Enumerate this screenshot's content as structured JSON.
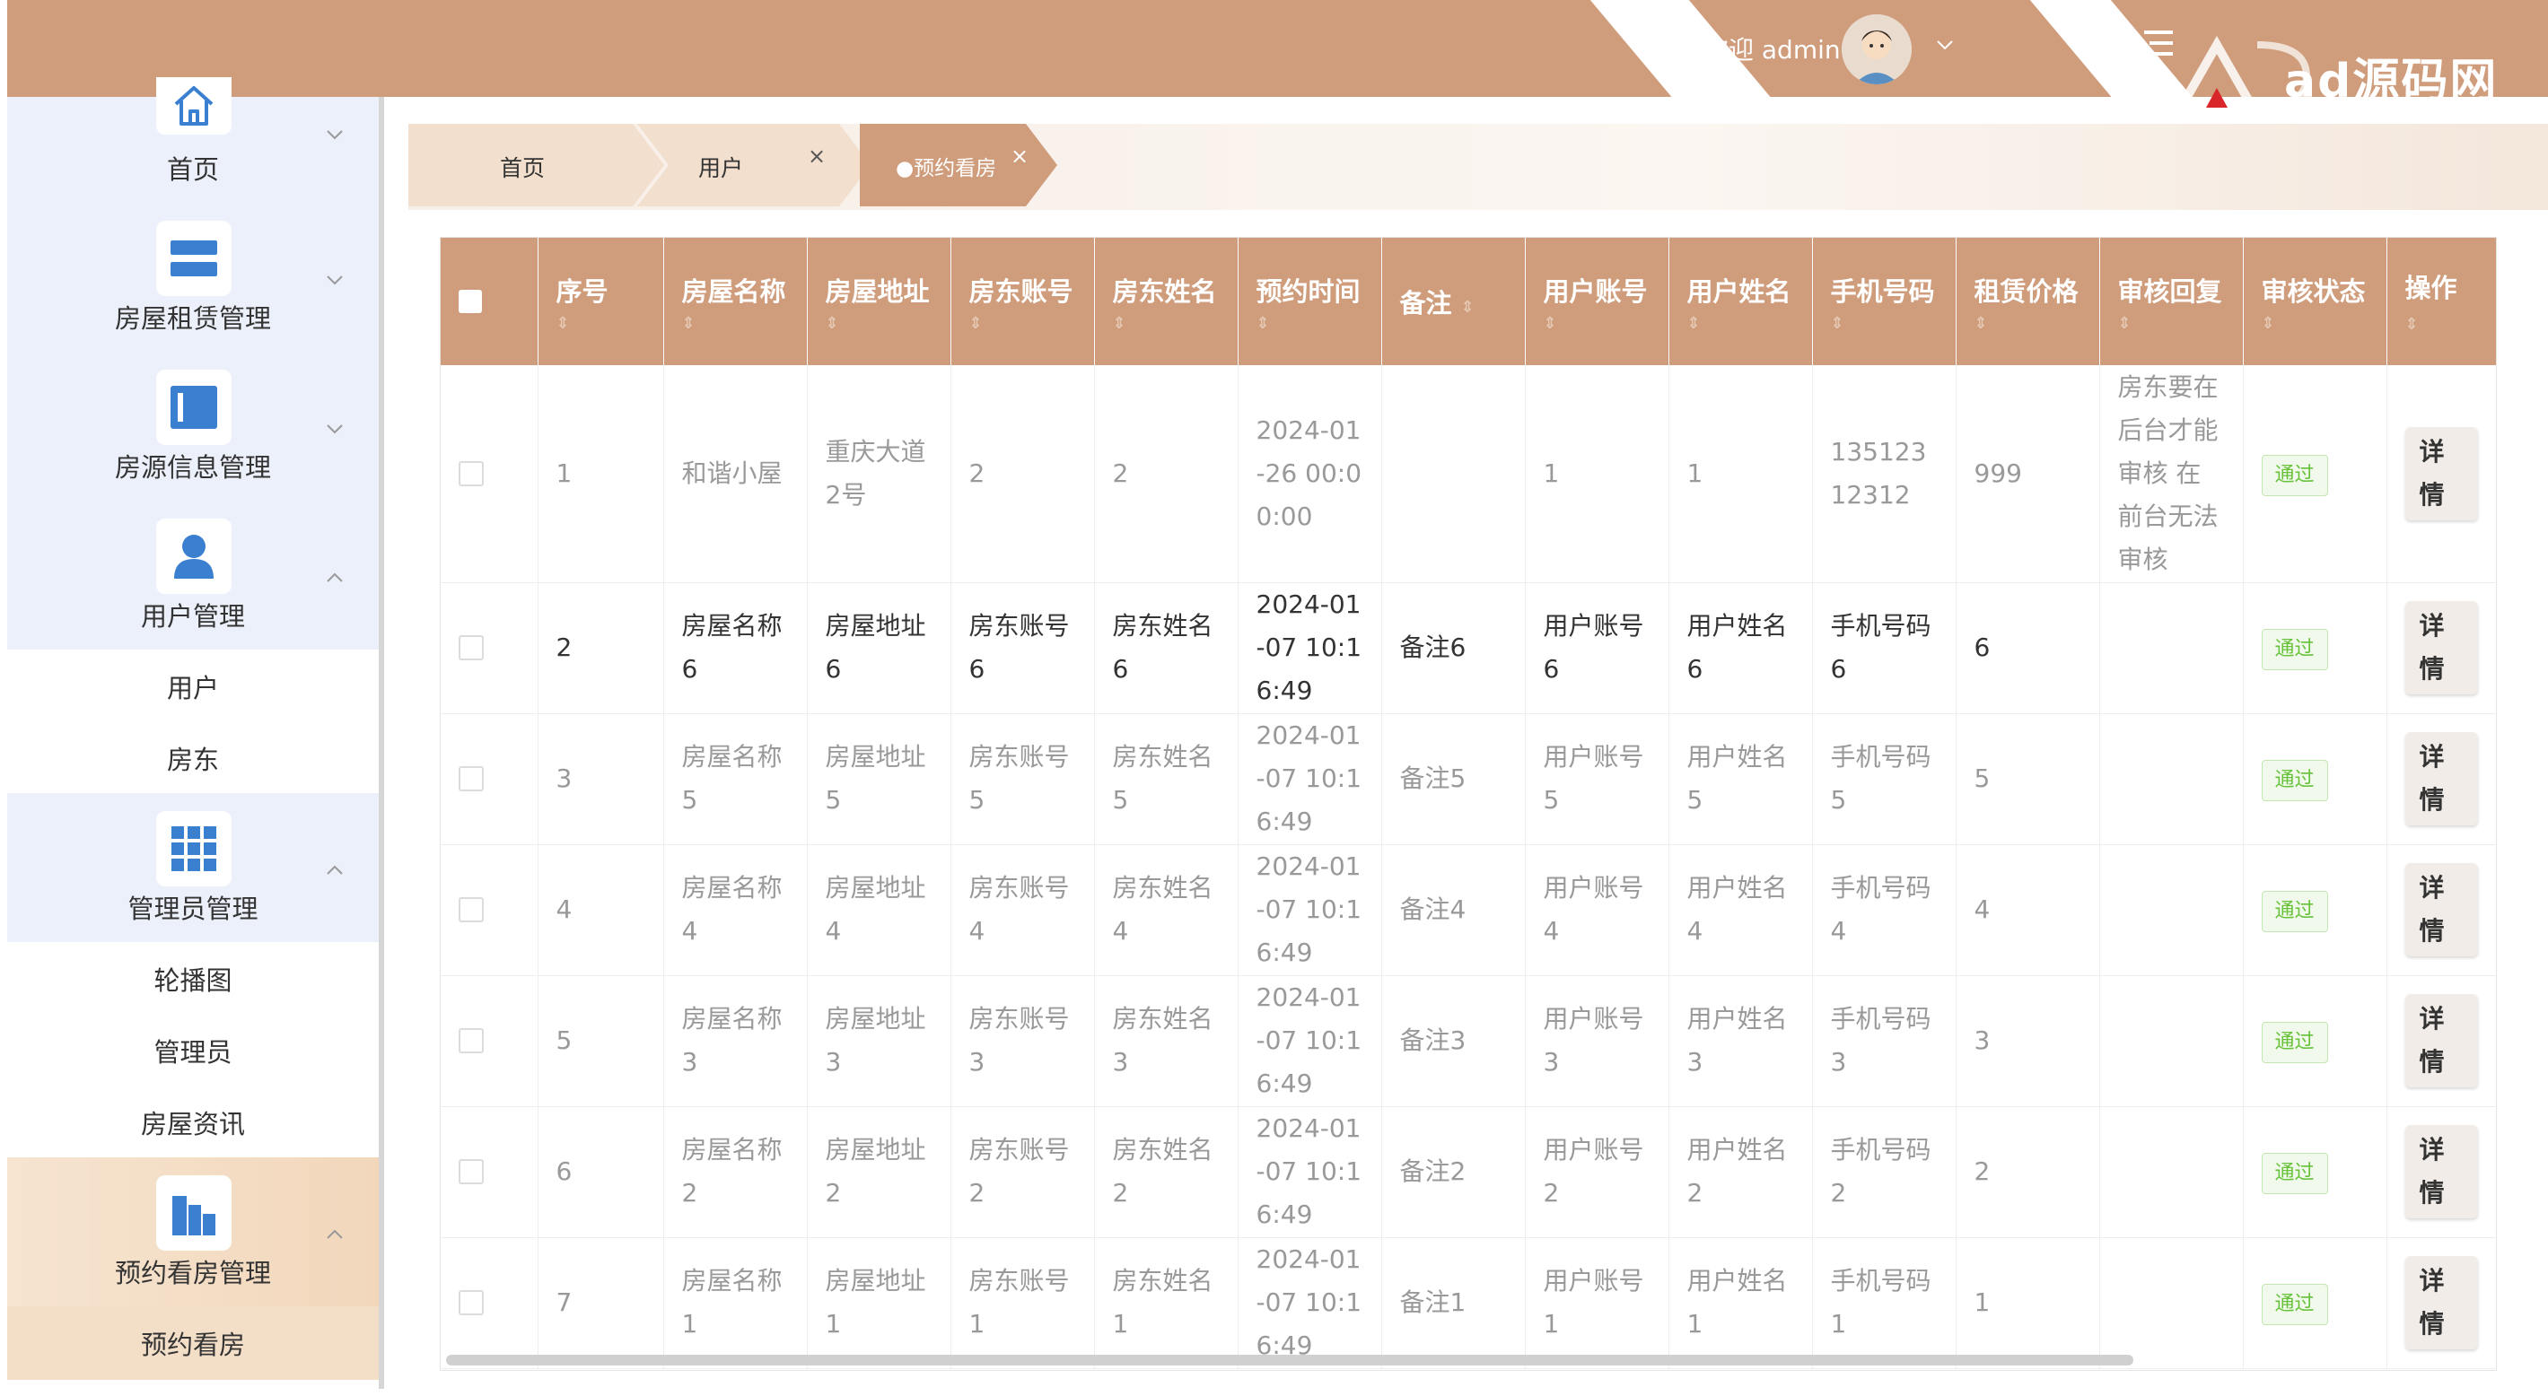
{
  "header": {
    "welcome": "欢迎 admin",
    "logo_text": "ad源码网",
    "colors": {
      "primary": "#cf9d7c",
      "sidebar_bg": "#ecf0fa",
      "badge_green": "#67c23a"
    }
  },
  "sidebar": {
    "menus": [
      {
        "label": "首页",
        "icon": "home-icon"
      },
      {
        "label": "房屋租赁管理",
        "icon": "list-icon"
      },
      {
        "label": "房源信息管理",
        "icon": "panel-icon"
      },
      {
        "label": "用户管理",
        "icon": "user-icon",
        "children": [
          "用户",
          "房东"
        ]
      },
      {
        "label": "管理员管理",
        "icon": "grid-icon",
        "children": [
          "轮播图",
          "管理员",
          "房屋资讯"
        ]
      },
      {
        "label": "预约看房管理",
        "icon": "building-icon",
        "children": [
          "预约看房"
        ]
      }
    ]
  },
  "tabs": [
    {
      "label": "首页",
      "closable": false
    },
    {
      "label": "用户",
      "closable": true
    },
    {
      "label": "●预约看房",
      "closable": true,
      "active": true
    }
  ],
  "table": {
    "columns": [
      "序号",
      "房屋名称",
      "房屋地址",
      "房东账号",
      "房东姓名",
      "预约时间",
      "备注",
      "用户账号",
      "用户姓名",
      "手机号码",
      "租赁价格",
      "审核回复",
      "审核状态",
      "操作"
    ],
    "sort_icon": "⇕",
    "detail_label": "详情",
    "rows": [
      {
        "cells": [
          "1",
          "和谐小屋",
          "重庆大道2号",
          "2",
          "2",
          "2024-01-26 00:00:00",
          "",
          "1",
          "1",
          "13512312312",
          "999",
          "房东要在后台才能审核 在前台无法审核"
        ],
        "status": "通过"
      },
      {
        "cells": [
          "2",
          "房屋名称6",
          "房屋地址6",
          "房东账号6",
          "房东姓名6",
          "2024-01-07 10:16:49",
          "备注6",
          "用户账号6",
          "用户姓名6",
          "手机号码6",
          "6",
          ""
        ],
        "status": "通过"
      },
      {
        "cells": [
          "3",
          "房屋名称5",
          "房屋地址5",
          "房东账号5",
          "房东姓名5",
          "2024-01-07 10:16:49",
          "备注5",
          "用户账号5",
          "用户姓名5",
          "手机号码5",
          "5",
          ""
        ],
        "status": "通过"
      },
      {
        "cells": [
          "4",
          "房屋名称4",
          "房屋地址4",
          "房东账号4",
          "房东姓名4",
          "2024-01-07 10:16:49",
          "备注4",
          "用户账号4",
          "用户姓名4",
          "手机号码4",
          "4",
          ""
        ],
        "status": "通过"
      },
      {
        "cells": [
          "5",
          "房屋名称3",
          "房屋地址3",
          "房东账号3",
          "房东姓名3",
          "2024-01-07 10:16:49",
          "备注3",
          "用户账号3",
          "用户姓名3",
          "手机号码3",
          "3",
          ""
        ],
        "status": "通过"
      },
      {
        "cells": [
          "6",
          "房屋名称2",
          "房屋地址2",
          "房东账号2",
          "房东姓名2",
          "2024-01-07 10:16:49",
          "备注2",
          "用户账号2",
          "用户姓名2",
          "手机号码2",
          "2",
          ""
        ],
        "status": "通过"
      },
      {
        "cells": [
          "7",
          "房屋名称1",
          "房屋地址1",
          "房东账号1",
          "房东姓名1",
          "2024-01-07 10:16:49",
          "备注1",
          "用户账号1",
          "用户姓名1",
          "手机号码1",
          "1",
          ""
        ],
        "status": "通过"
      }
    ]
  }
}
